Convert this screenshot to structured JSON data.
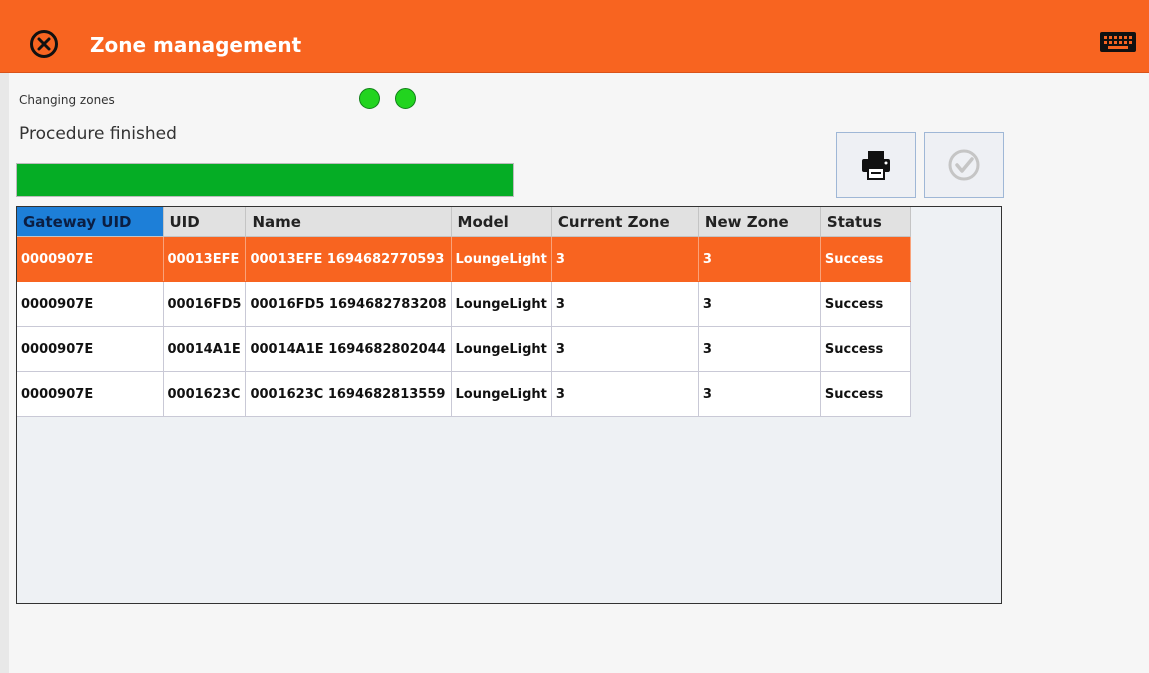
{
  "header": {
    "title": "Zone management",
    "close_icon": "close-circle-icon",
    "keyboard_icon": "keyboard-icon",
    "bg_color": "#f86420"
  },
  "status": {
    "label": "Changing zones",
    "message": "Procedure finished",
    "indicators": [
      "green",
      "green"
    ],
    "progress": 1.0
  },
  "toolbar": {
    "print_icon": "printer-icon",
    "confirm_icon": "check-circle-icon",
    "confirm_enabled": false
  },
  "grid": {
    "columns": [
      "Gateway UID",
      "UID",
      "Name",
      "Model",
      "Current Zone",
      "New Zone",
      "Status"
    ],
    "rows": [
      [
        "0000907E",
        "00013EFE",
        "00013EFE 1694682770593",
        "LoungeLight",
        "3",
        "3",
        "Success"
      ],
      [
        "0000907E",
        "00016FD5",
        "00016FD5 1694682783208",
        "LoungeLight",
        "3",
        "3",
        "Success"
      ],
      [
        "0000907E",
        "00014A1E",
        "00014A1E 1694682802044",
        "LoungeLight",
        "3",
        "3",
        "Success"
      ],
      [
        "0000907E",
        "0001623C",
        "0001623C 1694682813559",
        "LoungeLight",
        "3",
        "3",
        "Success"
      ]
    ],
    "selected_row": 0
  }
}
